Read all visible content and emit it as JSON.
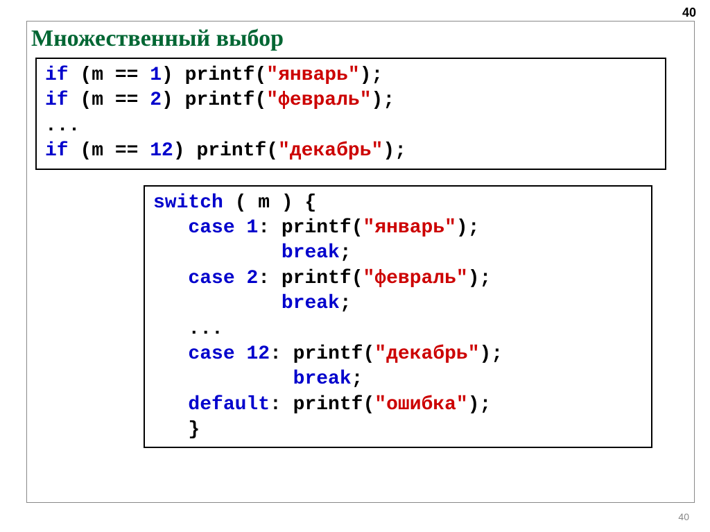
{
  "page_number_top": "40",
  "page_number_bottom": "40",
  "title": "Множественный выбор",
  "code1": {
    "tokens": [
      [
        {
          "t": "if",
          "c": "kw"
        },
        {
          "t": " (m == "
        },
        {
          "t": "1",
          "c": "num"
        },
        {
          "t": ") printf("
        },
        {
          "t": "\"январь\"",
          "c": "str"
        },
        {
          "t": ");"
        }
      ],
      [
        {
          "t": "if",
          "c": "kw"
        },
        {
          "t": " (m == "
        },
        {
          "t": "2",
          "c": "num"
        },
        {
          "t": ") printf("
        },
        {
          "t": "\"февраль\"",
          "c": "str"
        },
        {
          "t": ");"
        }
      ],
      [
        {
          "t": "..."
        }
      ],
      [
        {
          "t": "if",
          "c": "kw"
        },
        {
          "t": " (m == "
        },
        {
          "t": "12",
          "c": "num"
        },
        {
          "t": ") printf("
        },
        {
          "t": "\"декабрь\"",
          "c": "str"
        },
        {
          "t": ");"
        }
      ]
    ]
  },
  "code2": {
    "tokens": [
      [
        {
          "t": "switch",
          "c": "kw"
        },
        {
          "t": " ( m ) {"
        }
      ],
      [
        {
          "t": "   "
        },
        {
          "t": "case",
          "c": "kw"
        },
        {
          "t": " "
        },
        {
          "t": "1",
          "c": "num"
        },
        {
          "t": ": printf("
        },
        {
          "t": "\"январь\"",
          "c": "str"
        },
        {
          "t": ");"
        }
      ],
      [
        {
          "t": "           "
        },
        {
          "t": "break",
          "c": "kw"
        },
        {
          "t": ";"
        }
      ],
      [
        {
          "t": "   "
        },
        {
          "t": "case",
          "c": "kw"
        },
        {
          "t": " "
        },
        {
          "t": "2",
          "c": "num"
        },
        {
          "t": ": printf("
        },
        {
          "t": "\"февраль\"",
          "c": "str"
        },
        {
          "t": "); "
        }
      ],
      [
        {
          "t": "           "
        },
        {
          "t": "break",
          "c": "kw"
        },
        {
          "t": ";"
        }
      ],
      [
        {
          "t": "   ..."
        }
      ],
      [
        {
          "t": "   "
        },
        {
          "t": "case",
          "c": "kw"
        },
        {
          "t": " "
        },
        {
          "t": "12",
          "c": "num"
        },
        {
          "t": ": printf("
        },
        {
          "t": "\"декабрь\"",
          "c": "str"
        },
        {
          "t": ");"
        }
      ],
      [
        {
          "t": "            "
        },
        {
          "t": "break",
          "c": "kw"
        },
        {
          "t": ";"
        }
      ],
      [
        {
          "t": "   "
        },
        {
          "t": "default",
          "c": "kw"
        },
        {
          "t": ": printf("
        },
        {
          "t": "\"ошибка\"",
          "c": "str"
        },
        {
          "t": ");"
        }
      ],
      [
        {
          "t": "   }"
        }
      ]
    ]
  }
}
